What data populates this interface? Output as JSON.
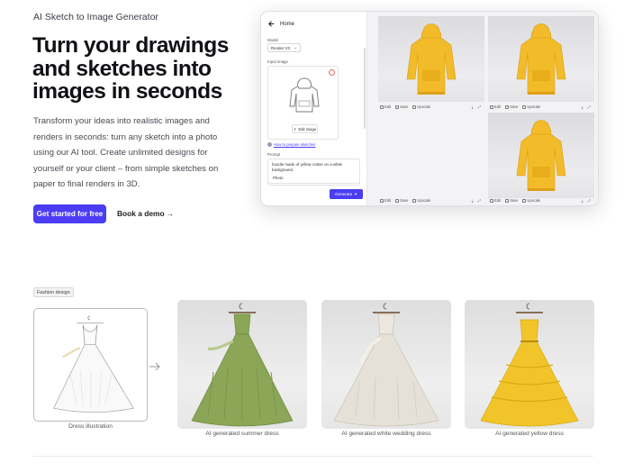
{
  "hero": {
    "eyebrow": "AI Sketch to Image Generator",
    "headline": "Turn your drawings and sketches into images in seconds",
    "description": "Transform your ideas into realistic images and renders in seconds: turn any sketch into a photo using our AI tool. Create unlimited designs for yourself or your client – from simple sketches on paper to final renders in 3D.",
    "cta_primary": "Get started for free",
    "cta_secondary": "Book a demo →"
  },
  "app": {
    "back_label": "Home",
    "model_label": "Model",
    "model_value": "Render V3",
    "input_label": "Input image",
    "edit_button": "Edit image",
    "how_link": "How to prepare sketches",
    "prompt_label": "Prompt",
    "prompt_text": "hoodie made of yellow cotton on a white background",
    "style_value": "Photo",
    "generate_label": "Generate",
    "tile_actions": {
      "edit": "Edit",
      "save": "Save",
      "upscale": "Upscale"
    },
    "tiles": [
      {
        "kind": "photo"
      },
      {
        "kind": "photo"
      },
      {
        "kind": "empty"
      },
      {
        "kind": "photo"
      }
    ]
  },
  "fashion": {
    "tag": "Fashion design",
    "sketch_caption": "Dress illustration",
    "items": [
      {
        "caption": "AI generated summer dress",
        "color": "#8aa656"
      },
      {
        "caption": "AI generated white wedding dress",
        "color": "#e5e1d8"
      },
      {
        "caption": "AI generated yellow dress",
        "color": "#f1c52a"
      }
    ]
  },
  "colors": {
    "accent": "#4b3cf5",
    "hoodie": "#f2bb2a"
  }
}
